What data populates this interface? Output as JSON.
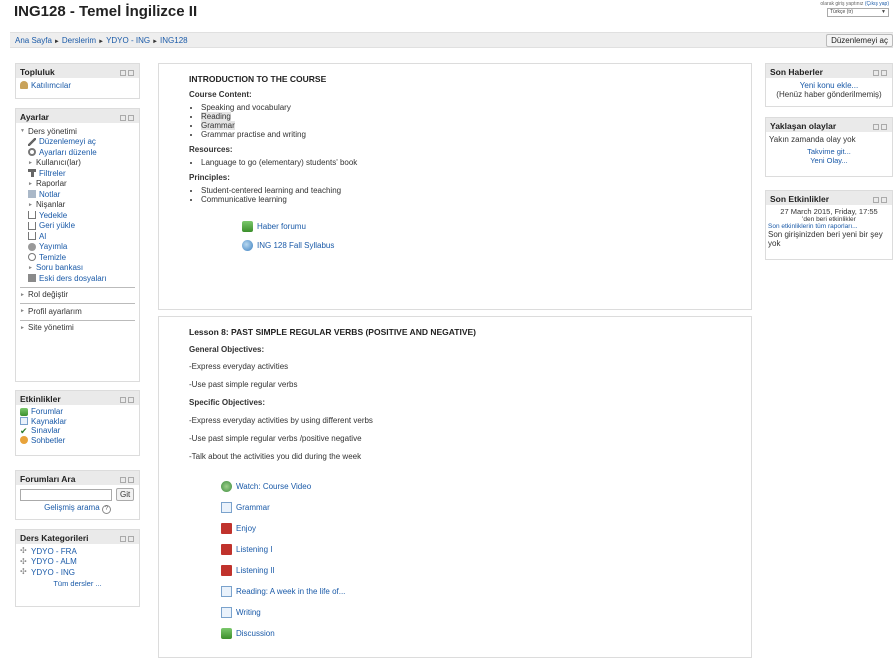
{
  "header": {
    "title": "ING128 - Temel İngilizce II",
    "login_text": "olarak giriş yaptınız",
    "logout_link": "(Çıkış yap)",
    "language": "Türkçe (tr)"
  },
  "breadcrumb": {
    "items": [
      "Ana Sayfa",
      "Derslerim",
      "YDYO - ING",
      "ING128"
    ],
    "separator": "►"
  },
  "edit_button": "Düzenlemeyi aç",
  "blocks": {
    "topluluk": {
      "title": "Topluluk",
      "items": [
        "Katılımcılar"
      ]
    },
    "ayarlar": {
      "title": "Ayarlar",
      "ders_yonetimi": "Ders yönetimi",
      "items": [
        "Düzenlemeyi aç",
        "Ayarları düzenle",
        "Kullanıcı(lar)",
        "Filtreler",
        "Raporlar",
        "Notlar",
        "Nişanlar",
        "Yedekle",
        "Geri yükle",
        "Al",
        "Yayımla",
        "Temizle",
        "Soru bankası",
        "Eski ders dosyaları"
      ],
      "rol": "Rol değiştir",
      "profil": "Profil ayarlarım",
      "site": "Site yönetimi"
    },
    "etkinlikler": {
      "title": "Etkinlikler",
      "items": [
        "Forumlar",
        "Kaynaklar",
        "Sınavlar",
        "Sohbetler"
      ]
    },
    "forum_ara": {
      "title": "Forumları Ara",
      "button": "Git",
      "advanced": "Gelişmiş arama"
    },
    "kategoriler": {
      "title": "Ders Kategorileri",
      "items": [
        "YDYO - FRA",
        "YDYO - ALM",
        "YDYO - ING"
      ],
      "all": "Tüm dersler ..."
    }
  },
  "right_blocks": {
    "haberler": {
      "title": "Son Haberler",
      "add": "Yeni konu ekle...",
      "empty": "(Henüz haber gönderilmemiş)"
    },
    "olaylar": {
      "title": "Yaklaşan olaylar",
      "empty": "Yakın zamanda olay yok",
      "calendar": "Takvime git...",
      "new_event": "Yeni Olay..."
    },
    "etkinlikler": {
      "title": "Son Etkinlikler",
      "date": "27 March 2015, Friday, 17:55",
      "since": "'den beri etkinlikler",
      "report": "Son etkinliklerin tüm raporları...",
      "note": "Son girişinizden beri yeni bir şey yok"
    }
  },
  "intro": {
    "title": "INTRODUCTION TO THE COURSE",
    "content_label": "Course Content:",
    "content_items": [
      "Speaking and vocabulary",
      "Reading",
      "Grammar",
      "Grammar practise and writing"
    ],
    "resources_label": "Resources:",
    "resources_items": [
      "Language to go (elementary) students' book"
    ],
    "principles_label": "Principles:",
    "principles_items": [
      "Student-centered learning and teaching",
      "Communicative learning"
    ],
    "links": [
      "Haber forumu",
      "ING 128 Fall Syllabus"
    ]
  },
  "lesson": {
    "title": "Lesson 8: PAST SIMPLE REGULAR VERBS (POSITIVE AND NEGATIVE)",
    "general_label": "General Objectives:",
    "general_items": [
      "-Express everyday activities",
      "-Use past simple regular verbs"
    ],
    "specific_label": "Specific Objectives:",
    "specific_items": [
      "-Express everyday activities by using different verbs",
      "-Use past simple regular verbs  /positive negative",
      "-Talk about the activities you did during the week"
    ],
    "links": [
      "Watch: Course Video",
      "Grammar",
      "Enjoy",
      "Listening I",
      "Listening II",
      "Reading: A week in the life of...",
      "Writing",
      "Discussion"
    ]
  }
}
